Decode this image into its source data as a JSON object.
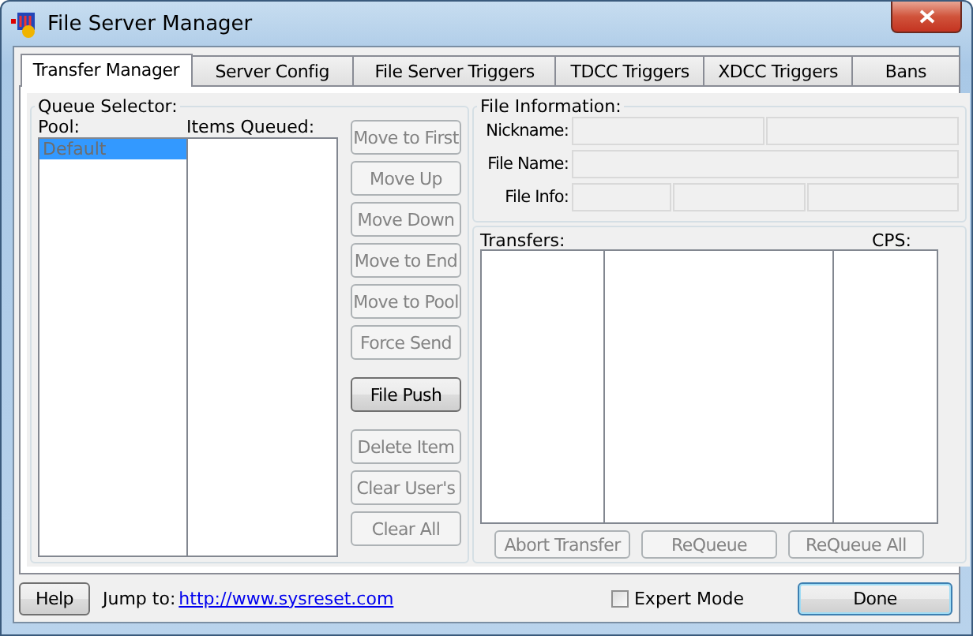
{
  "window": {
    "title": "File Server Manager"
  },
  "tabs": [
    {
      "label": "Transfer Manager",
      "selected": true
    },
    {
      "label": "Server Config",
      "selected": false
    },
    {
      "label": "File Server Triggers",
      "selected": false
    },
    {
      "label": "TDCC Triggers",
      "selected": false
    },
    {
      "label": "XDCC Triggers",
      "selected": false
    },
    {
      "label": "Bans",
      "selected": false
    }
  ],
  "queue_selector": {
    "title": "Queue Selector:",
    "pool_label": "Pool:",
    "items_label": "Items Queued:",
    "pool_items": [
      {
        "label": "Default",
        "selected": true
      }
    ],
    "buttons": [
      {
        "label": "Move to First",
        "disabled": true
      },
      {
        "label": "Move Up",
        "disabled": true
      },
      {
        "label": "Move Down",
        "disabled": true
      },
      {
        "label": "Move to End",
        "disabled": true
      },
      {
        "label": "Move to Pool",
        "disabled": true
      },
      {
        "label": "Force Send",
        "disabled": true
      },
      {
        "label": "File Push",
        "disabled": false
      },
      {
        "label": "Delete Item",
        "disabled": true
      },
      {
        "label": "Clear User's",
        "disabled": true
      },
      {
        "label": "Clear All",
        "disabled": true
      }
    ]
  },
  "file_information": {
    "title": "File Information:",
    "fields": [
      {
        "label": "Nickname:",
        "kind": "pair"
      },
      {
        "label": "File Name:",
        "kind": "single"
      },
      {
        "label": "File Info:",
        "kind": "triple"
      }
    ]
  },
  "transfers": {
    "label": "Transfers:",
    "cps_label": "CPS:",
    "buttons": [
      {
        "label": "Abort Transfer",
        "disabled": true
      },
      {
        "label": "ReQueue",
        "disabled": true
      },
      {
        "label": "ReQueue All",
        "disabled": true
      }
    ]
  },
  "footer": {
    "help": "Help",
    "jump_label": "Jump to:",
    "link": "http://www.sysreset.com",
    "expert_mode": {
      "label": "Expert Mode",
      "checked": false
    },
    "done": "Done"
  }
}
